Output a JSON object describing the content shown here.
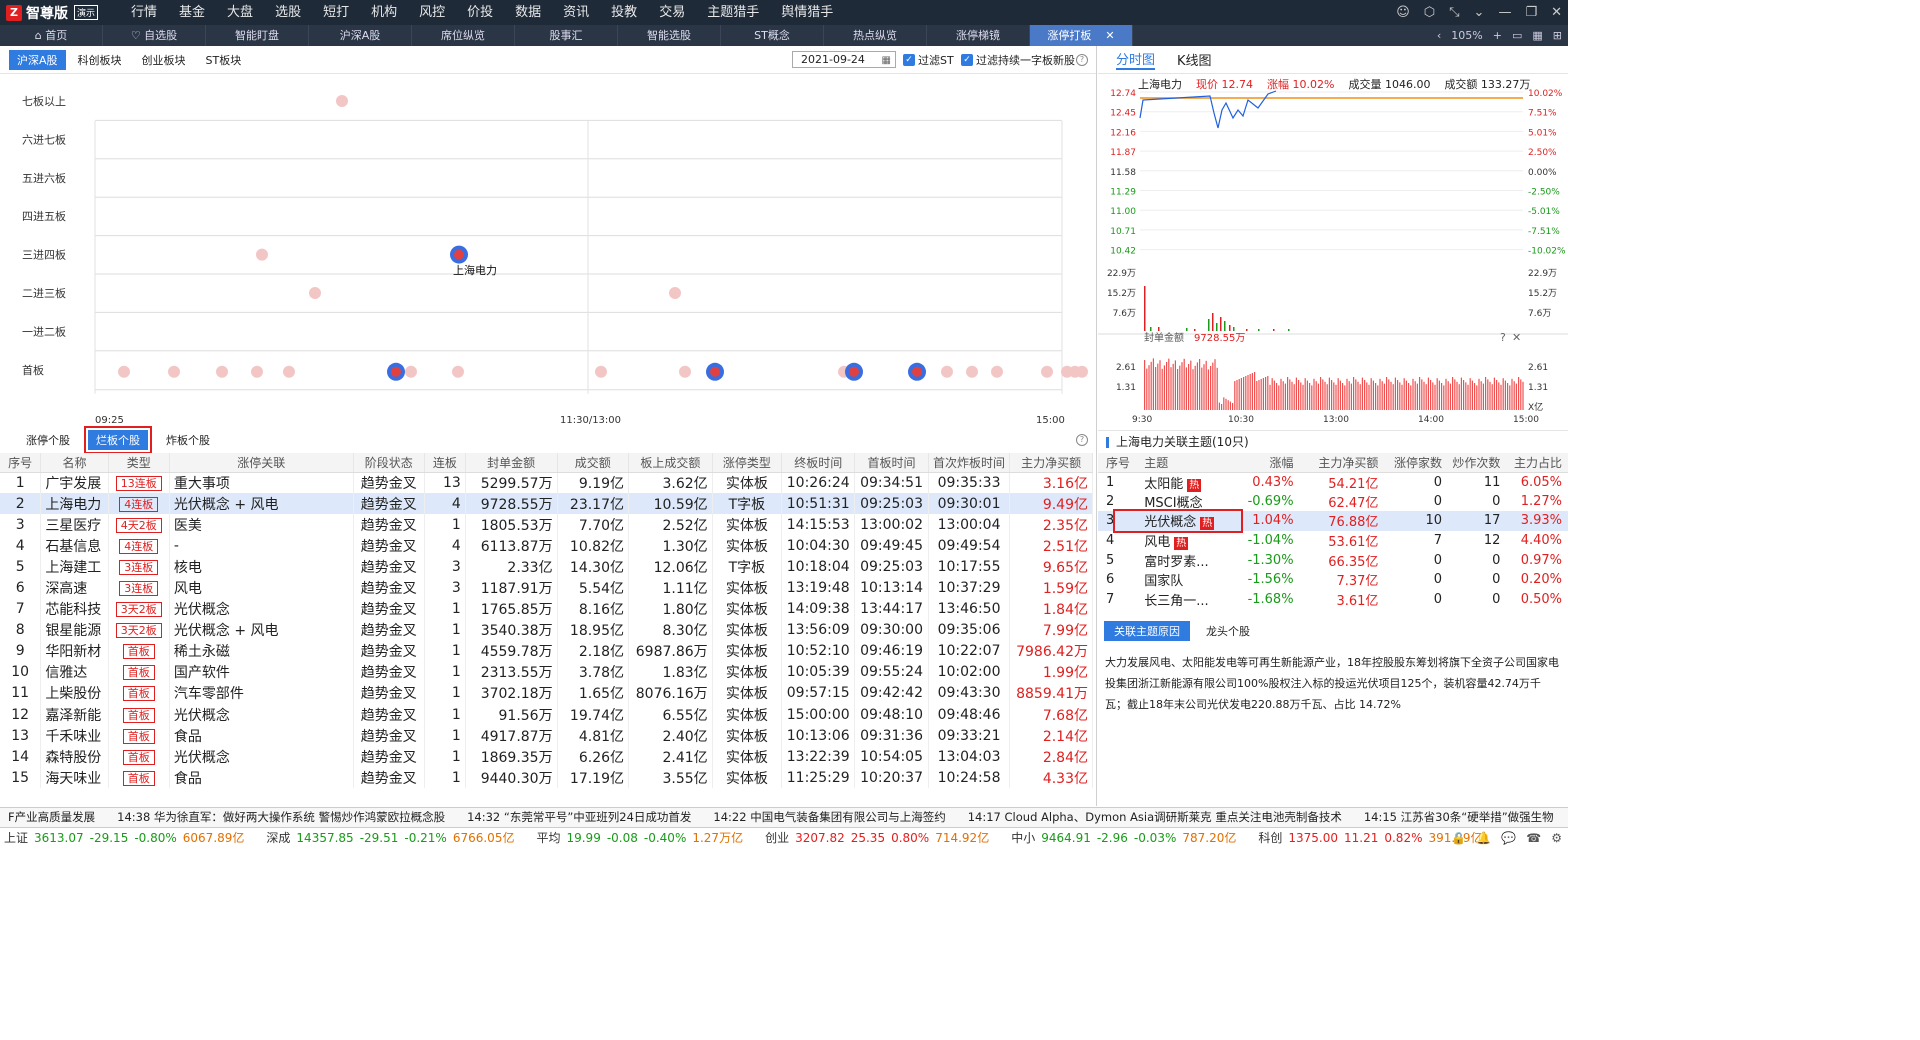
{
  "app": {
    "logo_mark": "Z",
    "title": "智尊版",
    "badge": "演示"
  },
  "menu": [
    "行情",
    "基金",
    "大盘",
    "选股",
    "短打",
    "机构",
    "风控",
    "价投",
    "数据",
    "资讯",
    "投教",
    "交易",
    "主题猎手",
    "舆情猎手"
  ],
  "tabs": [
    {
      "label": "首页",
      "icon": "home-icon"
    },
    {
      "label": "自选股",
      "icon": "heart-icon"
    },
    {
      "label": "智能盯盘"
    },
    {
      "label": "沪深A股"
    },
    {
      "label": "席位纵览"
    },
    {
      "label": "股事汇"
    },
    {
      "label": "智能选股"
    },
    {
      "label": "ST概念"
    },
    {
      "label": "热点纵览"
    },
    {
      "label": "涨停梯镜"
    },
    {
      "label": "涨停打板",
      "close": "✕"
    }
  ],
  "zoom": "105%",
  "market_tabs": [
    "沪深A股",
    "科创板块",
    "创业板块",
    "ST板块"
  ],
  "date": "2021-09-24",
  "filter_st": "过滤ST",
  "filter_new": "过滤持续一字板新股",
  "y_labels": [
    "七板以上",
    "六进七板",
    "五进六板",
    "四进五板",
    "三进四板",
    "二进三板",
    "一进二板",
    "首板"
  ],
  "x_labels": [
    "09:25",
    "11:30/13:00",
    "15:00"
  ],
  "scatter_label": "上海电力",
  "scatter_points": [
    {
      "r": 0,
      "t": 250,
      "hi": false
    },
    {
      "r": 4,
      "t": 170,
      "hi": false
    },
    {
      "r": 4,
      "t": 367,
      "hi": true
    },
    {
      "r": 5,
      "t": 223,
      "hi": false
    },
    {
      "r": 5,
      "t": 583,
      "hi": false
    },
    {
      "r": 7,
      "t": 32
    },
    {
      "r": 7,
      "t": 82
    },
    {
      "r": 7,
      "t": 130
    },
    {
      "r": 7,
      "t": 165
    },
    {
      "r": 7,
      "t": 197
    },
    {
      "r": 7,
      "t": 304,
      "hi": true
    },
    {
      "r": 7,
      "t": 319
    },
    {
      "r": 7,
      "t": 366
    },
    {
      "r": 7,
      "t": 509
    },
    {
      "r": 7,
      "t": 593
    },
    {
      "r": 7,
      "t": 623,
      "hi": true
    },
    {
      "r": 7,
      "t": 752
    },
    {
      "r": 7,
      "t": 762,
      "hi": true
    },
    {
      "r": 7,
      "t": 825,
      "hi": true
    },
    {
      "r": 7,
      "t": 855
    },
    {
      "r": 7,
      "t": 880
    },
    {
      "r": 7,
      "t": 905
    },
    {
      "r": 7,
      "t": 955
    },
    {
      "r": 7,
      "t": 975
    },
    {
      "r": 7,
      "t": 983
    },
    {
      "r": 7,
      "t": 990
    },
    {
      "r": 7,
      "t": 1020
    },
    {
      "r": 7,
      "t": 1027,
      "hi": true
    },
    {
      "r": 7,
      "t": 1045,
      "hi": true
    }
  ],
  "bottom_tabs": [
    "涨停个股",
    "烂板个股",
    "炸板个股"
  ],
  "stock_headers": [
    "序号",
    "名称",
    "类型",
    "涨停关联",
    "阶段状态",
    "连板",
    "封单金额",
    "成交额",
    "板上成交额",
    "涨停类型",
    "终板时间",
    "首板时间",
    "首次炸板时间",
    "主力净买额"
  ],
  "stocks": [
    [
      "1",
      "广宇发展",
      "13连板",
      "重大事项",
      "趋势金叉",
      "13",
      "5299.57万",
      "9.19亿",
      "3.62亿",
      "实体板",
      "10:26:24",
      "09:34:51",
      "09:35:33",
      "3.16亿"
    ],
    [
      "2",
      "上海电力",
      "4连板",
      "光伏概念 + 风电",
      "趋势金叉",
      "4",
      "9728.55万",
      "23.17亿",
      "10.59亿",
      "T字板",
      "10:51:31",
      "09:25:03",
      "09:30:01",
      "9.49亿"
    ],
    [
      "3",
      "三星医疗",
      "4天2板",
      "医美",
      "趋势金叉",
      "1",
      "1805.53万",
      "7.70亿",
      "2.52亿",
      "实体板",
      "14:15:53",
      "13:00:02",
      "13:00:04",
      "2.35亿"
    ],
    [
      "4",
      "石基信息",
      "4连板",
      "-",
      "趋势金叉",
      "4",
      "6113.87万",
      "10.82亿",
      "1.30亿",
      "实体板",
      "10:04:30",
      "09:49:45",
      "09:49:54",
      "2.51亿"
    ],
    [
      "5",
      "上海建工",
      "3连板",
      "核电",
      "趋势金叉",
      "3",
      "2.33亿",
      "14.30亿",
      "12.06亿",
      "T字板",
      "10:18:04",
      "09:25:03",
      "10:17:55",
      "9.65亿"
    ],
    [
      "6",
      "深高速",
      "3连板",
      "风电",
      "趋势金叉",
      "3",
      "1187.91万",
      "5.54亿",
      "1.11亿",
      "实体板",
      "13:19:48",
      "10:13:14",
      "10:37:29",
      "1.59亿"
    ],
    [
      "7",
      "芯能科技",
      "3天2板",
      "光伏概念",
      "趋势金叉",
      "1",
      "1765.85万",
      "8.16亿",
      "1.80亿",
      "实体板",
      "14:09:38",
      "13:44:17",
      "13:46:50",
      "1.84亿"
    ],
    [
      "8",
      "银星能源",
      "3天2板",
      "光伏概念 + 风电",
      "趋势金叉",
      "1",
      "3540.38万",
      "18.95亿",
      "8.30亿",
      "实体板",
      "13:56:09",
      "09:30:00",
      "09:35:06",
      "7.99亿"
    ],
    [
      "9",
      "华阳新材",
      "首板",
      "稀土永磁",
      "趋势金叉",
      "1",
      "4559.78万",
      "2.18亿",
      "6987.86万",
      "实体板",
      "10:52:10",
      "09:46:19",
      "10:22:07",
      "7986.42万"
    ],
    [
      "10",
      "信雅达",
      "首板",
      "国产软件",
      "趋势金叉",
      "1",
      "2313.55万",
      "3.78亿",
      "1.83亿",
      "实体板",
      "10:05:39",
      "09:55:24",
      "10:02:00",
      "1.99亿"
    ],
    [
      "11",
      "上柴股份",
      "首板",
      "汽车零部件",
      "趋势金叉",
      "1",
      "3702.18万",
      "1.65亿",
      "8076.16万",
      "实体板",
      "09:57:15",
      "09:42:42",
      "09:43:30",
      "8859.41万"
    ],
    [
      "12",
      "嘉泽新能",
      "首板",
      "光伏概念",
      "趋势金叉",
      "1",
      "91.56万",
      "19.74亿",
      "6.55亿",
      "实体板",
      "15:00:00",
      "09:48:10",
      "09:48:46",
      "7.68亿"
    ],
    [
      "13",
      "千禾味业",
      "首板",
      "食品",
      "趋势金叉",
      "1",
      "4917.87万",
      "4.81亿",
      "2.40亿",
      "实体板",
      "10:13:06",
      "09:31:36",
      "09:33:21",
      "2.14亿"
    ],
    [
      "14",
      "森特股份",
      "首板",
      "光伏概念",
      "趋势金叉",
      "1",
      "1869.35万",
      "6.26亿",
      "2.41亿",
      "实体板",
      "13:22:39",
      "10:54:05",
      "13:04:03",
      "2.84亿"
    ],
    [
      "15",
      "海天味业",
      "首板",
      "食品",
      "趋势金叉",
      "1",
      "9440.30万",
      "17.19亿",
      "3.55亿",
      "实体板",
      "11:25:29",
      "10:20:37",
      "10:24:58",
      "4.33亿"
    ]
  ],
  "right_tabs": [
    "分时图",
    "K线图"
  ],
  "chart_info": {
    "name": "上海电力",
    "price": "现价 12.74",
    "change": "涨幅 10.02%",
    "volume": "成交量 1046.00",
    "amount": "成交额 133.27万"
  },
  "price_left": [
    "12.74",
    "12.45",
    "12.16",
    "11.87",
    "11.58",
    "11.29",
    "11.00",
    "10.71",
    "10.42"
  ],
  "price_right": [
    "10.02%",
    "7.51%",
    "5.01%",
    "2.50%",
    "0.00%",
    "-2.50%",
    "-5.01%",
    "-7.51%",
    "-10.02%"
  ],
  "vol_labels": [
    "22.9万",
    "15.2万",
    "7.6万"
  ],
  "seal_title": "封单金额",
  "seal_value": "9728.55万",
  "seal_left": [
    "2.61",
    "1.31"
  ],
  "seal_right": [
    "2.61",
    "1.31",
    "X亿"
  ],
  "time_labels": [
    "9:30",
    "10:30",
    "13:00",
    "14:00",
    "15:00"
  ],
  "theme_title": "上海电力关联主题(10只)",
  "theme_headers": [
    "序号",
    "主题",
    "涨幅",
    "主力净买额",
    "涨停家数",
    "炒作次数",
    "主力占比"
  ],
  "themes": [
    [
      "1",
      "太阳能",
      true,
      "0.43%",
      "54.21亿",
      "0",
      "11",
      "6.05%"
    ],
    [
      "2",
      "MSCI概念",
      false,
      "-0.69%",
      "62.47亿",
      "0",
      "0",
      "1.27%"
    ],
    [
      "3",
      "光伏概念",
      true,
      "1.04%",
      "76.88亿",
      "10",
      "17",
      "3.93%"
    ],
    [
      "4",
      "风电",
      true,
      "-1.04%",
      "53.61亿",
      "7",
      "12",
      "4.40%"
    ],
    [
      "5",
      "富时罗素...",
      false,
      "-1.30%",
      "66.35亿",
      "0",
      "0",
      "0.97%"
    ],
    [
      "6",
      "国家队",
      false,
      "-1.56%",
      "7.37亿",
      "0",
      "0",
      "0.20%"
    ],
    [
      "7",
      "长三角一...",
      false,
      "-1.68%",
      "3.61亿",
      "0",
      "0",
      "0.50%"
    ]
  ],
  "hot_label": "热",
  "reason_tabs": [
    "关联主题原因",
    "龙头个股"
  ],
  "reason_text": "大力发展风电、太阳能发电等可再生新能源产业，18年控股股东筹划将旗下全资子公司国家电投集团浙江新能源有限公司100%股权注入标的投运光伏项目125个，装机容量42.74万千瓦；截止18年末公司光伏发电220.88万千瓦、占比 14.72%",
  "news": [
    "F产业高质量发展",
    "14:38 华为徐直军：做好两大操作系统 警惕炒作鸿蒙欧拉概念股",
    "14:32 “东莞常平号”中亚班列24日成功首发",
    "14:22 中国电气装备集团有限公司与上海签约",
    "14:17 Cloud Alpha、Dymon Asia调研斯莱克 重点关注电池壳制备技术",
    "14:15 江苏省30条“硬举措”做强生物"
  ],
  "indices": [
    {
      "name": "上证",
      "v": "3613.07",
      "c": "-29.15",
      "p": "-0.80%",
      "a": "6067.89亿",
      "up": false
    },
    {
      "name": "深成",
      "v": "14357.85",
      "c": "-29.51",
      "p": "-0.21%",
      "a": "6766.05亿",
      "up": false
    },
    {
      "name": "平均",
      "v": "19.99",
      "c": "-0.08",
      "p": "-0.40%",
      "a": "1.27万亿",
      "up": false
    },
    {
      "name": "创业",
      "v": "3207.82",
      "c": "25.35",
      "p": "0.80%",
      "a": "714.92亿",
      "up": true
    },
    {
      "name": "中小",
      "v": "9464.91",
      "c": "-2.96",
      "p": "-0.03%",
      "a": "787.20亿",
      "up": false
    },
    {
      "name": "科创",
      "v": "1375.00",
      "c": "11.21",
      "p": "0.82%",
      "a": "391.89亿",
      "up": true
    }
  ]
}
